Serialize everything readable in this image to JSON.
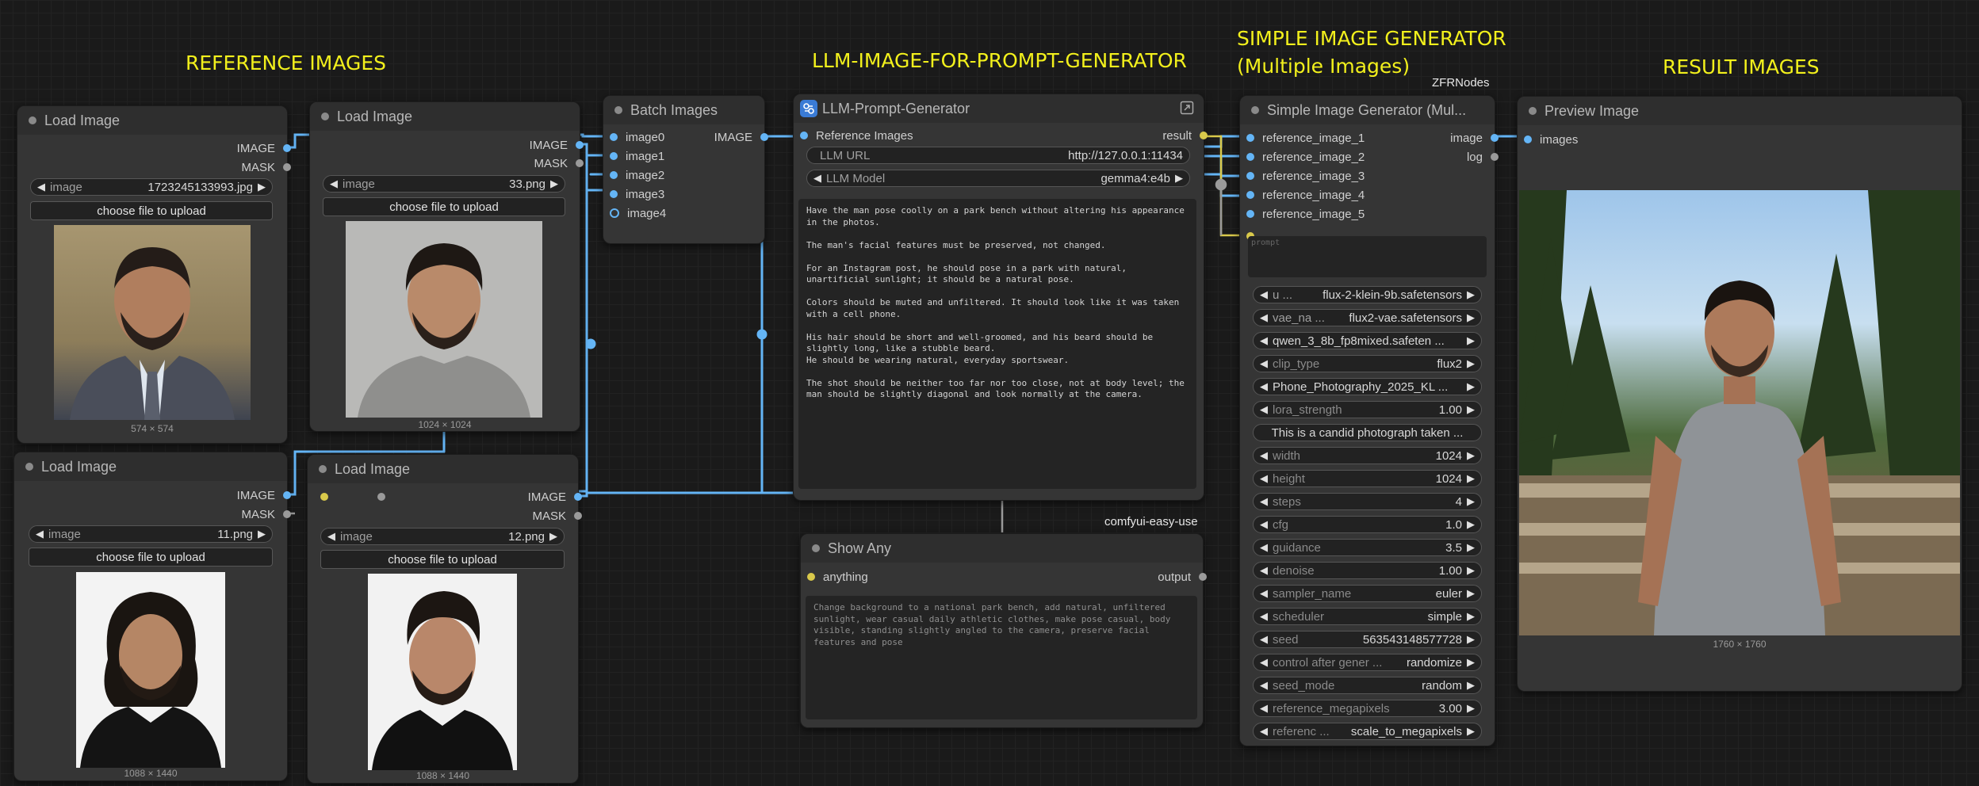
{
  "groups": {
    "reference_images": "REFERENCE IMAGES",
    "llm_prompt_generator": "LLM-IMAGE-FOR-PROMPT-GENERATOR",
    "simple_image_generator_line1": "SIMPLE IMAGE GENERATOR",
    "simple_image_generator_line2": "(Multiple Images)",
    "result_images": "RESULT IMAGES"
  },
  "brand_tags": {
    "zfr": "ZFRNodes",
    "easy_use": "comfyui-easy-use"
  },
  "load_image_1": {
    "title": "Load Image",
    "out_image": "IMAGE",
    "out_mask": "MASK",
    "image_label": "image",
    "image_value": "1723245133993.jpg",
    "upload": "choose file to upload",
    "dims": "574 × 574"
  },
  "load_image_2": {
    "title": "Load Image",
    "out_image": "IMAGE",
    "out_mask": "MASK",
    "image_label": "image",
    "image_value": "33.png",
    "upload": "choose file to upload",
    "dims": "1024 × 1024"
  },
  "load_image_3": {
    "title": "Load Image",
    "out_image": "IMAGE",
    "out_mask": "MASK",
    "image_label": "image",
    "image_value": "11.png",
    "upload": "choose file to upload",
    "dims": "1088 × 1440"
  },
  "load_image_4": {
    "title": "Load Image",
    "out_image": "IMAGE",
    "out_mask": "MASK",
    "image_label": "image",
    "image_value": "12.png",
    "upload": "choose file to upload",
    "dims": "1088 × 1440"
  },
  "batch_images": {
    "title": "Batch Images",
    "inputs": [
      "image0",
      "image1",
      "image2",
      "image3",
      "image4"
    ],
    "output": "IMAGE"
  },
  "llm_prompt": {
    "title": "LLM-Prompt-Generator",
    "input": "Reference Images",
    "output": "result",
    "url_label": "LLM URL",
    "url_value": "http://127.0.0.1:11434",
    "model_label": "LLM Model",
    "model_value": "gemma4:e4b",
    "prompt_text": "Have the man pose coolly on a park bench without altering his appearance in the photos.\n\nThe man's facial features must be preserved, not changed.\n\nFor an Instagram post, he should pose in a park with natural, unartificial sunlight; it should be a natural pose.\n\nColors should be muted and unfiltered. It should look like it was taken with a cell phone.\n\nHis hair should be short and well-groomed, and his beard should be slightly long, like a stubble beard.\nHe should be wearing natural, everyday sportswear.\n\nThe shot should be neither too far nor too close, not at body level; the man should be slightly diagonal and look normally at the camera."
  },
  "show_any": {
    "title": "Show Any",
    "input": "anything",
    "output": "output",
    "text": "Change background to a national park bench, add natural, unfiltered sunlight, wear casual daily athletic clothes, make pose casual, body visible, standing slightly angled to the camera, preserve facial features and pose"
  },
  "simple_gen": {
    "title": "Simple Image Generator (Mul...",
    "inputs": [
      "reference_image_1",
      "reference_image_2",
      "reference_image_3",
      "reference_image_4",
      "reference_image_5"
    ],
    "outputs": [
      "image",
      "log"
    ],
    "prompt_placeholder": "prompt",
    "widgets": [
      {
        "label": "u ...",
        "value": "flux-2-klein-9b.safetensors",
        "dim": false
      },
      {
        "label": "vae_na ...",
        "value": "flux2-vae.safetensors",
        "dim": false
      },
      {
        "label": "",
        "value": "qwen_3_8b_fp8mixed.safeten ...",
        "dim": false
      },
      {
        "label": "clip_type",
        "value": "flux2",
        "dim": true
      },
      {
        "label": "",
        "value": "Phone_Photography_2025_KL ...",
        "dim": false
      },
      {
        "label": "lora_strength",
        "value": "1.00",
        "dim": true
      },
      {
        "label": "",
        "value": "This is a candid photograph taken ...",
        "dim": false,
        "text": true
      },
      {
        "label": "width",
        "value": "1024",
        "dim": true
      },
      {
        "label": "height",
        "value": "1024",
        "dim": true
      },
      {
        "label": "steps",
        "value": "4",
        "dim": true
      },
      {
        "label": "cfg",
        "value": "1.0",
        "dim": true
      },
      {
        "label": "guidance",
        "value": "3.5",
        "dim": true
      },
      {
        "label": "denoise",
        "value": "1.00",
        "dim": true
      },
      {
        "label": "sampler_name",
        "value": "euler",
        "dim": true
      },
      {
        "label": "scheduler",
        "value": "simple",
        "dim": true
      },
      {
        "label": "seed",
        "value": "563543148577728",
        "dim": true
      },
      {
        "label": "control after gener ...",
        "value": "randomize",
        "dim": true
      },
      {
        "label": "seed_mode",
        "value": "random",
        "dim": true
      },
      {
        "label": "reference_megapixels",
        "value": "3.00",
        "dim": true
      },
      {
        "label": "referenc ...",
        "value": "scale_to_megapixels",
        "dim": true
      }
    ]
  },
  "preview": {
    "title": "Preview Image",
    "input": "images",
    "dims": "1760 × 1760"
  },
  "colors": {
    "wire_image": "#64b5f6",
    "wire_string": "#d9c94b",
    "group_title": "#f2f01c",
    "canvas": "#1a1a1a",
    "node_body": "#353535"
  }
}
